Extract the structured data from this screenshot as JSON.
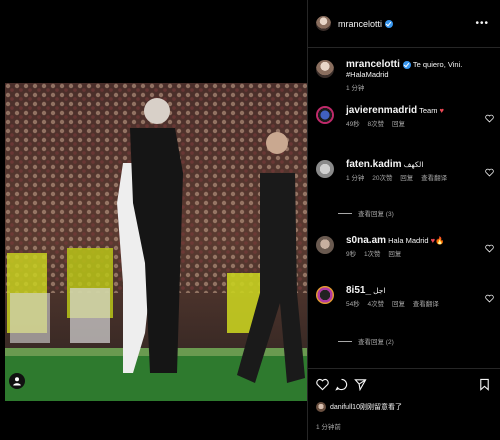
{
  "header": {
    "username": "mrancelotti",
    "more_icon": "more-horizontal-icon"
  },
  "caption": {
    "username": "mrancelotti",
    "text": "Te quiero, Vini. #HalaMadrid",
    "time": "1 分钟"
  },
  "comments": [
    {
      "username": "javierenmadrid",
      "text": "Team",
      "emoji": "♥",
      "time": "49秒",
      "likes": "8次赞",
      "reply": "回复",
      "translate": "",
      "replies": ""
    },
    {
      "username": "faten.kadim",
      "text": "الكهف",
      "emoji": "",
      "time": "1 分钟",
      "likes": "20次赞",
      "reply": "回复",
      "translate": "查看翻译",
      "replies": "查看回复 (3)"
    },
    {
      "username": "s0na.am",
      "text": "Hala Madrid",
      "emoji": "♥🔥",
      "time": "9秒",
      "likes": "1次赞",
      "reply": "回复",
      "translate": "",
      "replies": ""
    },
    {
      "username": "8i51_",
      "text": "اجل",
      "emoji": "",
      "time": "54秒",
      "likes": "4次赞",
      "reply": "回复",
      "translate": "查看翻译",
      "replies": "查看回复 (2)"
    }
  ],
  "footer": {
    "liked_by": "danifull10刚刚留意看了",
    "time": "1 分钟前"
  },
  "colors": {
    "verified": "#3897f0",
    "heart_red": "#ed4956",
    "muted": "#a8a8a8"
  }
}
